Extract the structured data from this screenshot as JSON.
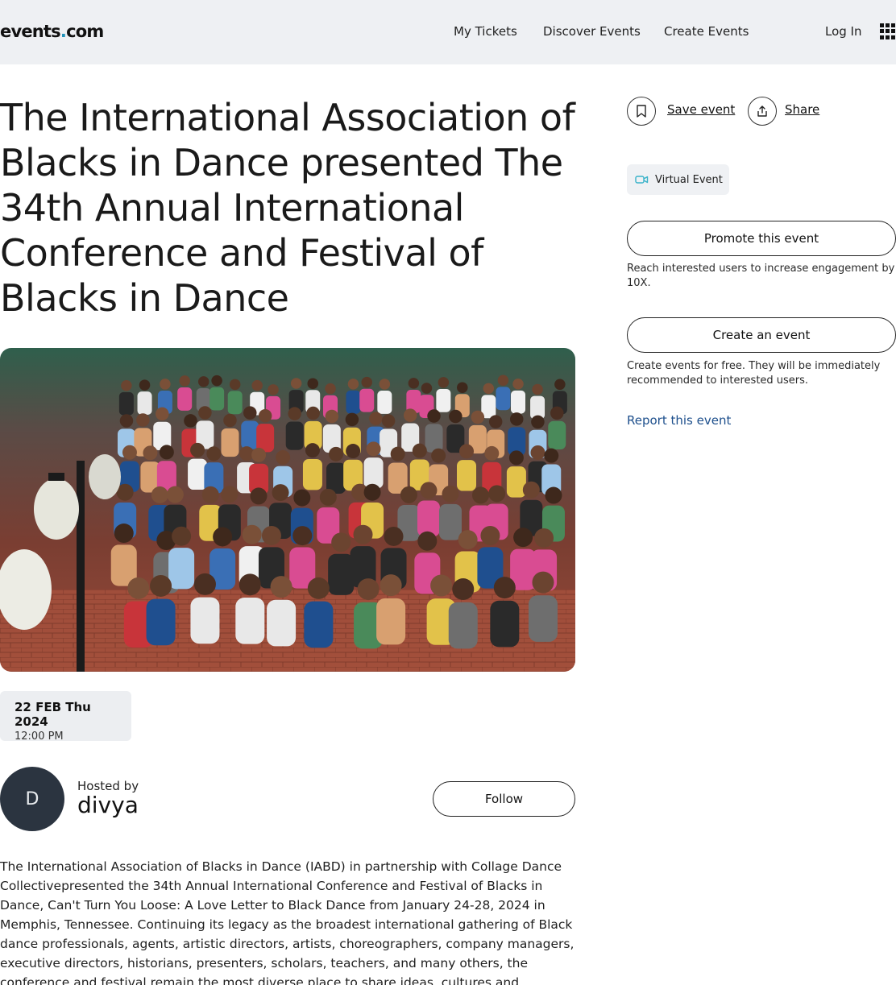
{
  "header": {
    "logo_main": "events",
    "logo_dot": ".",
    "logo_tld": "com",
    "nav": {
      "my_tickets": "My Tickets",
      "discover_events": "Discover Events",
      "create_events": "Create Events",
      "log_in": "Log In"
    },
    "apps_icon": "grid-menu-icon"
  },
  "event": {
    "title": "The International Association of Blacks in Dance presented The 34th Annual International Conference and Festival of Blacks in Dance",
    "hero_image": "group-photo-of-dancers",
    "date": "22 FEB Thu 2024",
    "time": "12:00 PM",
    "host": {
      "label": "Hosted by",
      "name": "divya",
      "initial": "D",
      "follow_label": "Follow"
    },
    "description": "The International Association of Blacks in Dance (IABD) in partnership with Collage Dance Collectivepresented the 34th Annual International Conference and Festival of Blacks in Dance, Can't Turn You Loose: A Love Letter to Black Dance from January 24-28, 2024 in Memphis, Tennessee. Continuing its legacy as the broadest international gathering of Black dance professionals, agents, artistic directors, artists, choreographers, company managers, executive directors, historians, presenters, scholars, teachers, and many others, the conference and festival remain the most diverse place to share ideas, cultures and experiences."
  },
  "sidebar": {
    "save_label": "Save event",
    "share_label": "Share",
    "virtual_badge": "Virtual Event",
    "promote_button": "Promote this event",
    "promote_help": "Reach interested users to increase engagement by 10X.",
    "create_button": "Create an event",
    "create_help": "Create events for free. They will be immediately recommended to interested users.",
    "report_link": "Report this event"
  },
  "colors": {
    "accent": "#1e90b8",
    "header_bg": "#eef0f3",
    "avatar_bg": "#2b3440",
    "report_link": "#1d4f8c",
    "virtual_icon": "#38b2c9"
  }
}
